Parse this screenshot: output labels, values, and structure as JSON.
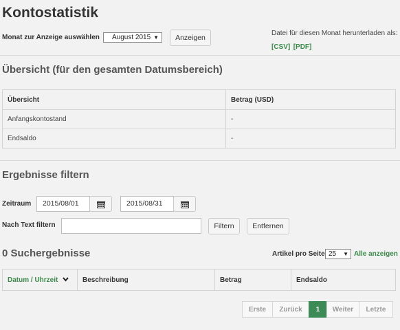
{
  "page_title": "Kontostatistik",
  "month_select": {
    "label": "Monat zur Anzeige auswählen",
    "value": "August 2015",
    "button": "Anzeigen"
  },
  "download": {
    "text": "Datei für diesen Monat herunterladen als:",
    "csv": "[CSV]",
    "pdf": "[PDF]"
  },
  "overview": {
    "heading": "Übersicht (für den gesamten Datumsbereich)",
    "columns": [
      "Übersicht",
      "Betrag (USD)"
    ],
    "rows": [
      {
        "label": "Anfangskontostand",
        "value": "-"
      },
      {
        "label": "Endsaldo",
        "value": "-"
      }
    ]
  },
  "filter": {
    "heading": "Ergebnisse filtern",
    "date_label": "Zeitraum",
    "date_from": "2015/08/01",
    "date_to": "2015/08/31",
    "text_label": "Nach Text filtern",
    "text_value": "",
    "filter_button": "Filtern",
    "remove_button": "Entfernen"
  },
  "results": {
    "heading": "0 Suchergebnisse",
    "per_page_label": "Artikel pro Seite",
    "per_page_value": "25",
    "show_all": "Alle anzeigen",
    "columns": [
      "Datum / Uhrzeit",
      "Beschreibung",
      "Betrag",
      "Endsaldo"
    ]
  },
  "pagination": {
    "first": "Erste",
    "prev": "Zurück",
    "current": "1",
    "next": "Weiter",
    "last": "Letzte"
  },
  "colors": {
    "accent": "#3c8a56",
    "link": "#3c8a4a",
    "background": "#f2f2f2"
  }
}
